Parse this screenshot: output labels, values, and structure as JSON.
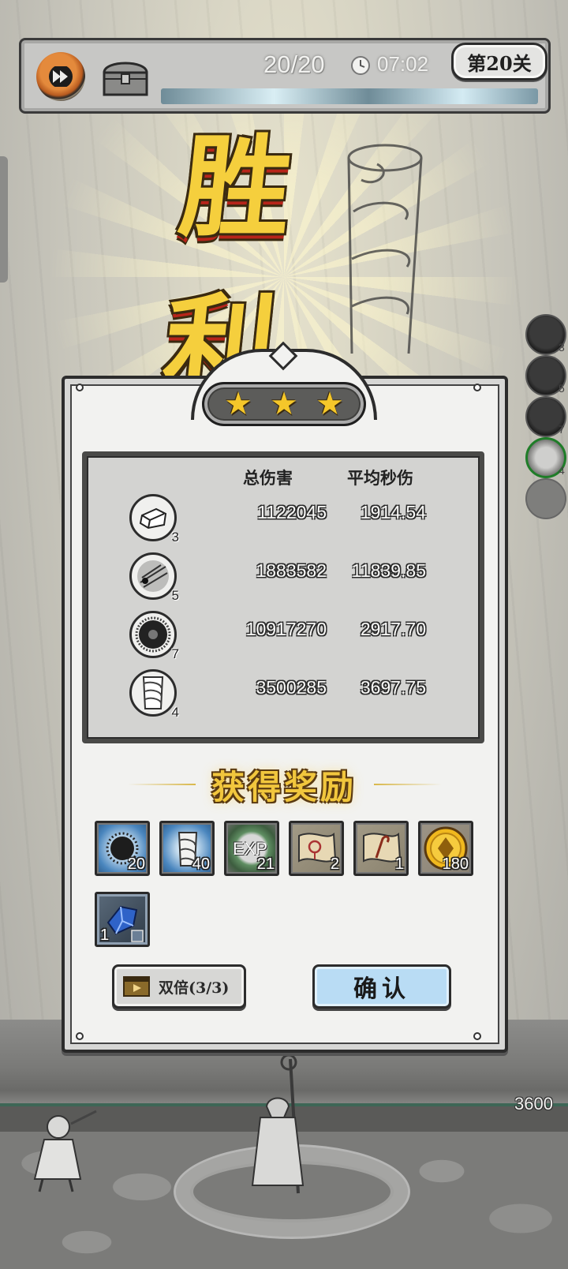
{
  "hud": {
    "wave": "20/20",
    "time": "07:02",
    "level": "第20关",
    "wave_progress": 1.0
  },
  "victory": {
    "title": "胜利",
    "stars": 3
  },
  "stats": {
    "header_total": "总伤害",
    "header_dps": "平均秒伤",
    "rows": [
      {
        "icon": "ice-cube-skill-icon",
        "level": "3",
        "total": "1122045",
        "dps": "1914.54"
      },
      {
        "icon": "slash-skill-icon",
        "level": "5",
        "total": "1883582",
        "dps": "11839.85"
      },
      {
        "icon": "dark-burst-skill-icon",
        "level": "7",
        "total": "10917270",
        "dps": "2917.70"
      },
      {
        "icon": "whirlwind-skill-icon",
        "level": "4",
        "total": "3500285",
        "dps": "3697.75"
      }
    ]
  },
  "side_levels": [
    "3",
    "5",
    "7",
    "4"
  ],
  "rewards": {
    "title": "获得奖励",
    "items": [
      {
        "icon": "dark-burst-card-icon",
        "count": "20"
      },
      {
        "icon": "whirlwind-card-icon",
        "count": "40"
      },
      {
        "icon": "exp-orb-icon",
        "label": "EXP",
        "count": "21"
      },
      {
        "icon": "scroll-pendant-icon",
        "count": "2"
      },
      {
        "icon": "scroll-staff-icon",
        "count": "1"
      },
      {
        "icon": "gold-coin-icon",
        "count": "180"
      },
      {
        "icon": "blue-crystal-icon",
        "count": "1"
      }
    ]
  },
  "buttons": {
    "double": "双倍(3/3)",
    "confirm": "确认"
  },
  "hp": "3600"
}
